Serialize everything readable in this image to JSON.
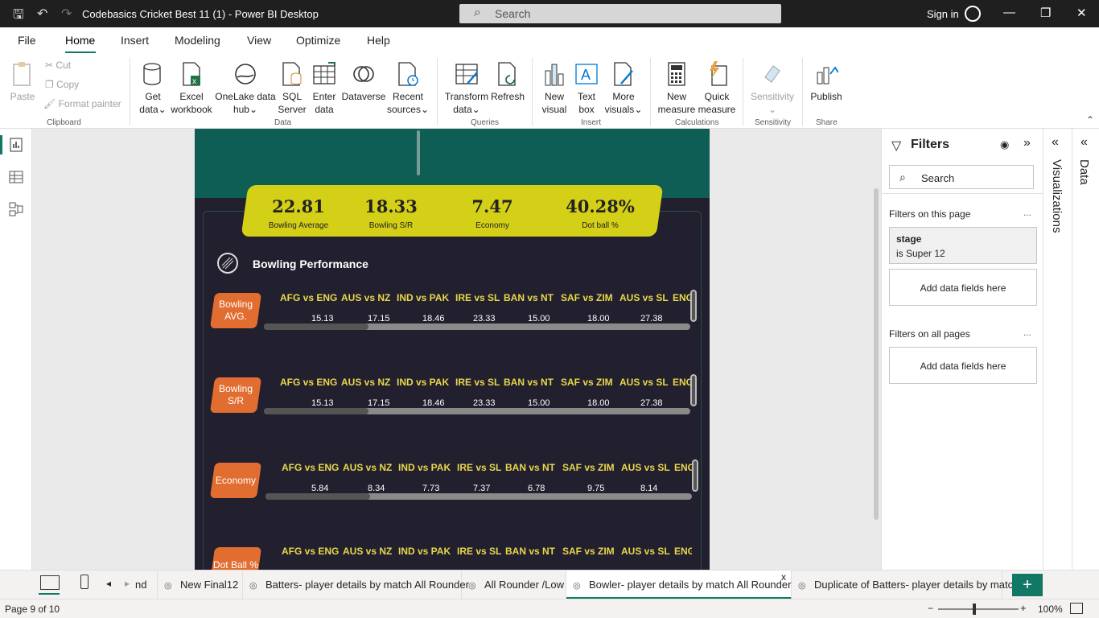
{
  "window": {
    "title": "Codebasics Cricket Best 11 (1) - Power BI Desktop",
    "search_placeholder": "Search",
    "sign_in": "Sign in"
  },
  "menu": {
    "tabs": [
      "File",
      "Home",
      "Insert",
      "Modeling",
      "View",
      "Optimize",
      "Help"
    ],
    "active": "Home"
  },
  "ribbon": {
    "clipboard": {
      "paste": "Paste",
      "cut": "Cut",
      "copy": "Copy",
      "format_painter": "Format painter",
      "group": "Clipboard"
    },
    "data": {
      "get_data": [
        "Get",
        "data"
      ],
      "excel": [
        "Excel",
        "workbook"
      ],
      "onelake": [
        "OneLake data",
        "hub"
      ],
      "sql": [
        "SQL",
        "Server"
      ],
      "enter": [
        "Enter",
        "data"
      ],
      "dataverse": [
        "Dataverse",
        ""
      ],
      "recent": [
        "Recent",
        "sources"
      ],
      "group": "Data"
    },
    "queries": {
      "transform": [
        "Transform",
        "data"
      ],
      "refresh": [
        "Refresh",
        ""
      ],
      "group": "Queries"
    },
    "insert": {
      "new_visual": [
        "New",
        "visual"
      ],
      "text_box": [
        "Text",
        "box"
      ],
      "more_visuals": [
        "More",
        "visuals"
      ],
      "group": "Insert"
    },
    "calculations": {
      "new_measure": [
        "New",
        "measure"
      ],
      "quick_measure": [
        "Quick",
        "measure"
      ],
      "group": "Calculations"
    },
    "sensitivity": {
      "label": "Sensitivity",
      "group": "Sensitivity"
    },
    "share": {
      "publish": "Publish",
      "group": "Share"
    }
  },
  "report": {
    "kpis": [
      {
        "value": "22.81",
        "label": "Bowling Average"
      },
      {
        "value": "18.33",
        "label": "Bowling S/R"
      },
      {
        "value": "7.47",
        "label": "Economy"
      },
      {
        "value": "40.28%",
        "label": "Dot ball %"
      }
    ],
    "section_title": "Bowling Performance",
    "matches": [
      "AFG vs ENG",
      "AUS vs NZ",
      "IND vs PAK",
      "IRE vs SL",
      "BAN vs NT",
      "SAF vs ZIM",
      "AUS vs SL",
      "ENG"
    ],
    "rows": [
      {
        "label_1": "Bowling",
        "label_2": "AVG.",
        "values": [
          "15.13",
          "17.15",
          "18.46",
          "23.33",
          "15.00",
          "18.00",
          "27.38"
        ]
      },
      {
        "label_1": "Bowling",
        "label_2": "S/R",
        "values": [
          "15.13",
          "17.15",
          "18.46",
          "23.33",
          "15.00",
          "18.00",
          "27.38"
        ]
      },
      {
        "label_1": "Economy",
        "label_2": "",
        "values": [
          "5.84",
          "8.34",
          "7.73",
          "7.37",
          "6.78",
          "9.75",
          "8.14"
        ]
      },
      {
        "label_1": "Dot Ball %",
        "label_2": "",
        "values": []
      }
    ],
    "colors": {
      "kpi_bg": "#d4cf17",
      "header_bg": "#0e5e56",
      "page_bg": "#221f2f",
      "label_bg": "#e26d30",
      "match_text": "#e8d84a"
    }
  },
  "filters": {
    "title": "Filters",
    "search_placeholder": "Search",
    "on_this_page": "Filters on this page",
    "card_field": "stage",
    "card_value": "is Super 12",
    "add_fields": "Add data fields here",
    "on_all_pages": "Filters on all pages",
    "dots": "..."
  },
  "panes": {
    "visualizations": "Visualizations",
    "data": "Data"
  },
  "page_tabs": {
    "items": [
      {
        "label": "nd",
        "active": false
      },
      {
        "label": "New Final12",
        "active": false
      },
      {
        "label": "Batters- player details by match All Rounder",
        "active": false
      },
      {
        "label": "All Rounder /Low",
        "active": false
      },
      {
        "label": "Bowler- player details by match All Rounder",
        "active": true
      },
      {
        "label": "Duplicate of Batters- player details by matc...",
        "active": false
      }
    ],
    "close": "x",
    "add": "+"
  },
  "status": {
    "page": "Page 9 of 10",
    "zoom": "100%"
  }
}
